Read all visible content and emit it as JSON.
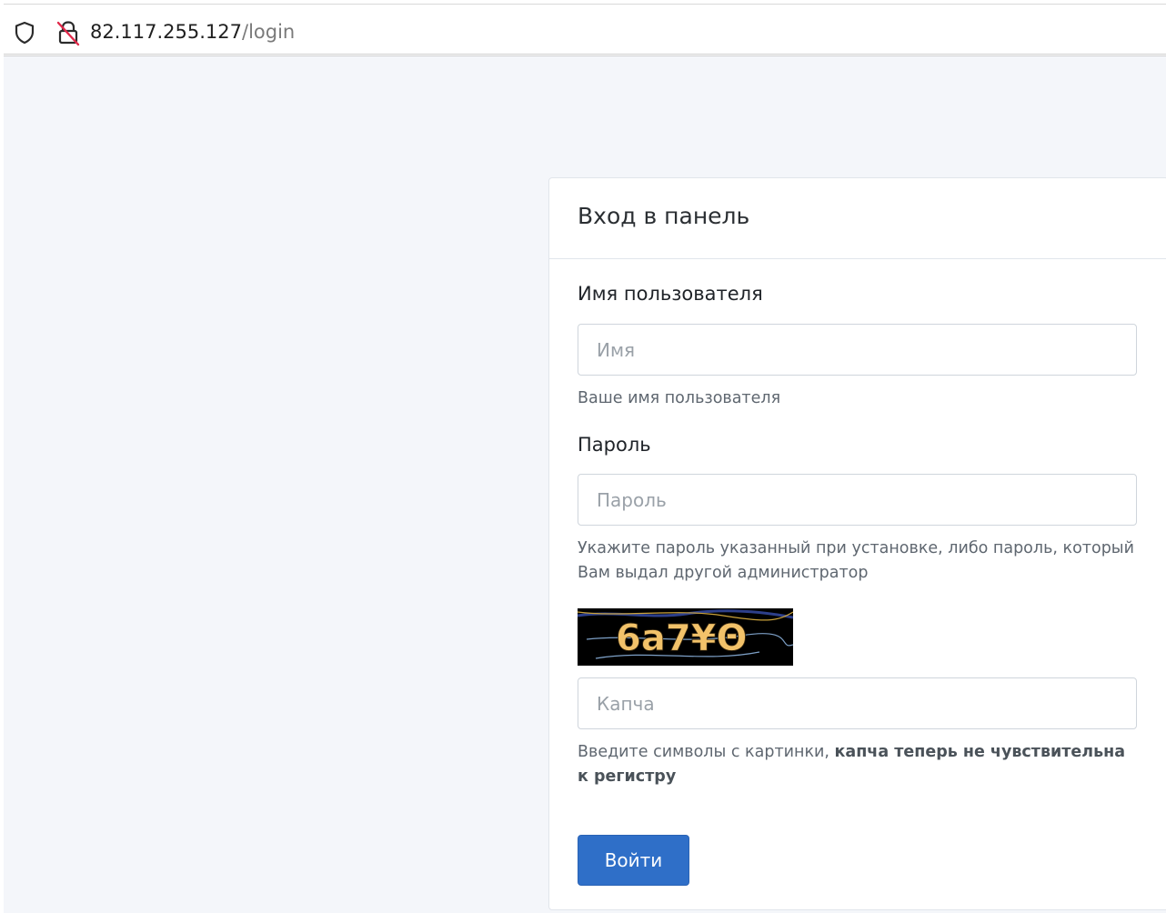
{
  "browser": {
    "url_host": "82.117.255.127",
    "url_path": "/login"
  },
  "login": {
    "title": "Вход в панель",
    "username_label": "Имя пользователя",
    "username_placeholder": "Имя",
    "username_help": "Ваше имя пользователя",
    "password_label": "Пароль",
    "password_placeholder": "Пароль",
    "password_help": "Укажите пароль указанный при установке, либо пароль, который Вам выдал другой администратор",
    "captcha_text": "6a7¥Θ",
    "captcha_placeholder": "Капча",
    "captcha_help_prefix": "Введите символы с картинки, ",
    "captcha_help_bold": "капча теперь не чувствительна к регистру",
    "submit_label": "Войти"
  },
  "colors": {
    "primary_button": "#2f6fc8",
    "page_background": "#f4f6fa"
  }
}
